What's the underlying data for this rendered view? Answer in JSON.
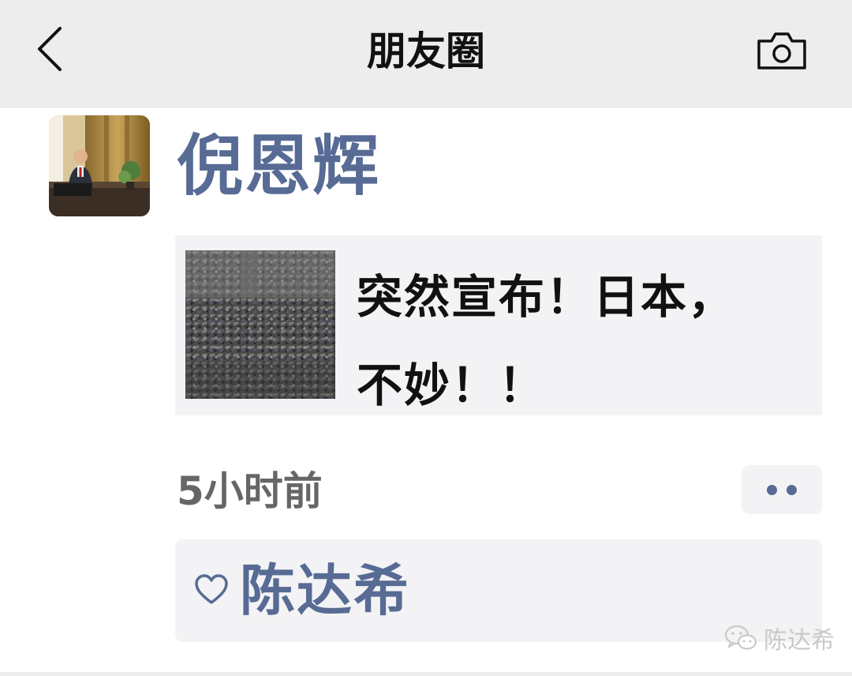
{
  "navbar": {
    "title": "朋友圈",
    "back_icon": "chevron-left-icon",
    "camera_icon": "camera-icon"
  },
  "post": {
    "author": "倪恩辉",
    "link_card": {
      "title_line1": "突然宣布！日本，",
      "title_line2": "不妙！！"
    },
    "time": "5小时前",
    "more_icon": "more-dots-icon",
    "likes": {
      "icon": "heart-icon",
      "names": "陈达希"
    }
  },
  "watermark": {
    "icon": "wechat-icon",
    "text": "陈达希"
  },
  "colors": {
    "nav_background": "#ededed",
    "name_link": "#576b95",
    "card_background": "#f3f3f5",
    "time_text": "#666666"
  }
}
